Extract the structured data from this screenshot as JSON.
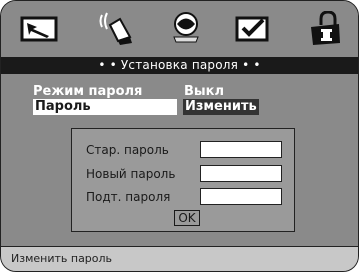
{
  "icons": {
    "setup": "setup-icon",
    "sound": "speaker-icon",
    "display": "display-icon",
    "preferences": "checkbox-icon",
    "lock": "lock-icon"
  },
  "title": "• • Установка пароля • •",
  "settings": [
    {
      "label": "Режим пароля",
      "value": "Выкл"
    },
    {
      "label": "Пароль",
      "value": "Изменить"
    }
  ],
  "dialog": {
    "old_label": "Стар. пароль",
    "old_value": "",
    "new_label": "Новый пароль",
    "new_value": "",
    "confirm_label": "Подт. пароля",
    "confirm_value": "",
    "ok_label": "OK"
  },
  "status": "Изменить пароль",
  "colors": {
    "background": "#8a8a8a",
    "title_bar": "#1a1a1a",
    "highlight": "#ffffff",
    "status_bar": "#c8c8c8"
  }
}
